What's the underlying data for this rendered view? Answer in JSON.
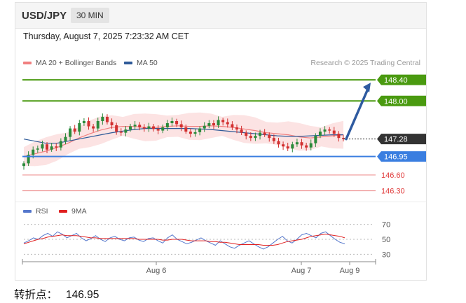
{
  "header": {
    "symbol": "USD/JPY",
    "interval": "30 MIN"
  },
  "datetime": "Thursday, August 7, 2025 7:23:32 AM CET",
  "legend": {
    "ma20": {
      "label": "MA 20 + Bollinger Bands",
      "color": "#f08080"
    },
    "ma50": {
      "label": "MA 50",
      "color": "#2e5a98"
    }
  },
  "copyright": "Research © 2025 Trading Central",
  "rsi_legend": {
    "rsi": {
      "label": "RSI",
      "color": "#5577cc"
    },
    "ma9": {
      "label": "9MA",
      "color": "#e02020"
    }
  },
  "caption": {
    "label": "转折点：",
    "value": "146.95"
  },
  "colors": {
    "green": "#4a9a10",
    "blue": "#3a7ee0",
    "red": "#e03a3a",
    "arrow": "#2e5aa0",
    "dark": "#333333"
  },
  "chart_data": [
    {
      "type": "candlestick",
      "symbol": "USD/JPY",
      "timeframe": "30 MIN",
      "ylim": [
        146.15,
        148.6
      ],
      "x_ticks": [
        "Aug 6",
        "Aug 7",
        "Aug 9"
      ],
      "levels": [
        {
          "value": 148.4,
          "label": "148.40",
          "role": "target",
          "color": "#4a9a10"
        },
        {
          "value": 148.0,
          "label": "148.00",
          "role": "target",
          "color": "#4a9a10"
        },
        {
          "value": 147.28,
          "label": "147.28",
          "role": "last",
          "color": "#333333"
        },
        {
          "value": 146.95,
          "label": "146.95",
          "role": "pivot",
          "color": "#3a7ee0"
        },
        {
          "value": 146.6,
          "label": "146.60",
          "role": "support",
          "color": "#e03a3a"
        },
        {
          "value": 146.3,
          "label": "146.30",
          "role": "support",
          "color": "#e03a3a"
        }
      ],
      "close_series": [
        146.82,
        146.98,
        147.08,
        147.1,
        147.18,
        147.08,
        147.14,
        147.12,
        147.24,
        147.32,
        147.48,
        147.42,
        147.58,
        147.62,
        147.52,
        147.48,
        147.62,
        147.7,
        147.6,
        147.54,
        147.42,
        147.4,
        147.46,
        147.52,
        147.55,
        147.5,
        147.48,
        147.52,
        147.47,
        147.44,
        147.5,
        147.58,
        147.62,
        147.56,
        147.5,
        147.42,
        147.38,
        147.41,
        147.48,
        147.53,
        147.58,
        147.54,
        147.64,
        147.6,
        147.56,
        147.5,
        147.46,
        147.4,
        147.34,
        147.3,
        147.34,
        147.4,
        147.36,
        147.3,
        147.24,
        147.18,
        147.14,
        147.1,
        147.18,
        147.22,
        147.16,
        147.12,
        147.2,
        147.34,
        147.42,
        147.46,
        147.44,
        147.38,
        147.3,
        147.28
      ],
      "ma20_series": [
        146.95,
        147.0,
        147.05,
        147.12,
        147.2,
        147.3,
        147.38,
        147.45,
        147.5,
        147.52,
        147.52,
        147.5,
        147.5,
        147.52,
        147.53,
        147.52,
        147.52,
        147.53,
        147.52,
        147.5,
        147.47,
        147.44,
        147.4,
        147.38,
        147.36,
        147.32,
        147.3,
        147.32,
        147.34,
        147.36
      ],
      "ma50_series": [
        147.28,
        147.24,
        147.2,
        147.2,
        147.24,
        147.28,
        147.32,
        147.36,
        147.4,
        147.43,
        147.46,
        147.48,
        147.48,
        147.48,
        147.48,
        147.48,
        147.47,
        147.46,
        147.44,
        147.42,
        147.4,
        147.38,
        147.36,
        147.34,
        147.33,
        147.33,
        147.34,
        147.35,
        147.36,
        147.36
      ],
      "bollinger_width": 0.22,
      "forecast_target": 148.4
    },
    {
      "type": "line",
      "title": "RSI",
      "ylim": [
        20,
        80
      ],
      "y_ticks": [
        70,
        50,
        30
      ],
      "series": [
        {
          "name": "RSI",
          "values": [
            45,
            48,
            52,
            50,
            55,
            58,
            54,
            60,
            57,
            52,
            55,
            58,
            52,
            48,
            51,
            55,
            50,
            47,
            52,
            54,
            50,
            48,
            52,
            53,
            49,
            47,
            51,
            52,
            48,
            45,
            52,
            56,
            50,
            47,
            44,
            46,
            49,
            52,
            48,
            45,
            42,
            48,
            44,
            40,
            38,
            42,
            45,
            48,
            44,
            40,
            37,
            40,
            45,
            50,
            54,
            48,
            45,
            50,
            56,
            58,
            55,
            52,
            58,
            60,
            55,
            50,
            46,
            44
          ]
        },
        {
          "name": "9MA",
          "values": [
            44,
            46,
            48,
            50,
            51,
            53,
            54,
            55,
            56,
            55,
            55,
            55,
            54,
            53,
            52,
            52,
            51,
            51,
            51,
            51,
            51,
            51,
            51,
            51,
            50,
            50,
            50,
            50,
            50,
            49,
            49,
            50,
            50,
            50,
            49,
            48,
            48,
            48,
            48,
            47,
            47,
            46,
            46,
            45,
            44,
            43,
            43,
            43,
            43,
            43,
            42,
            42,
            42,
            43,
            45,
            47,
            48,
            49,
            50,
            52,
            54,
            55,
            56,
            57,
            56,
            55,
            54,
            52
          ]
        }
      ]
    }
  ]
}
